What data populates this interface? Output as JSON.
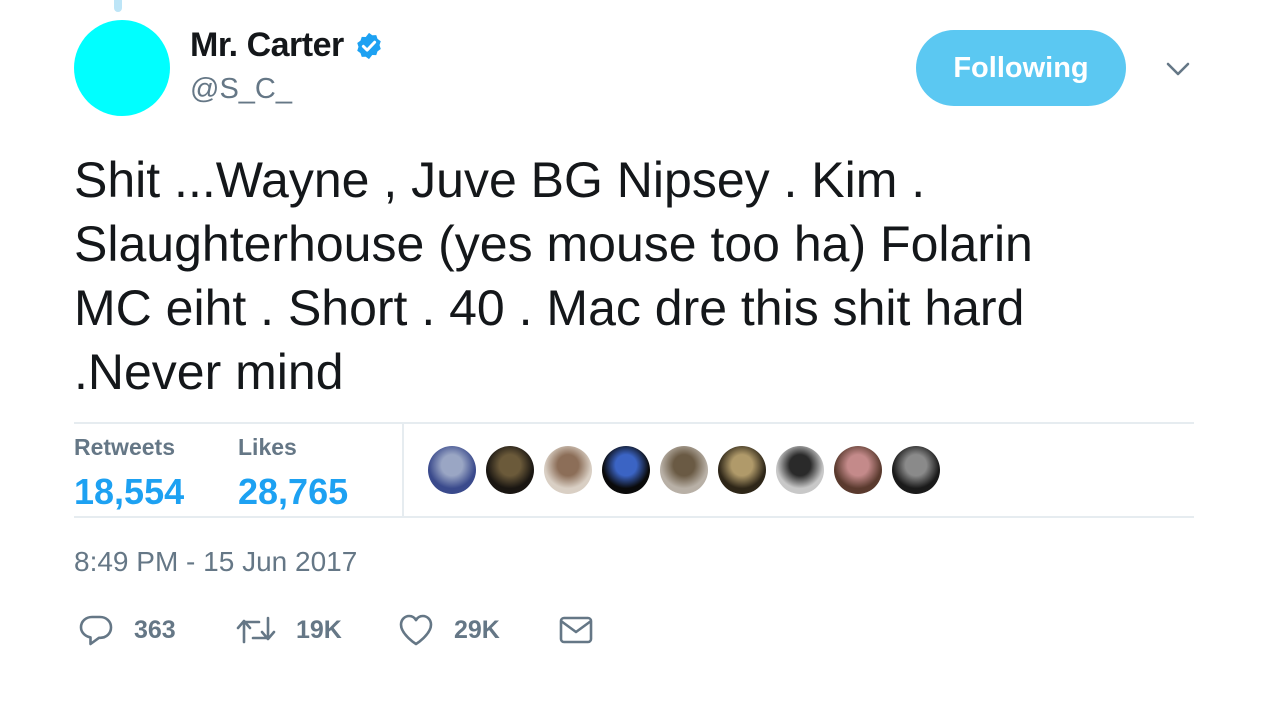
{
  "colors": {
    "accent": "#1da1f2",
    "follow_button": "#5bc8f2",
    "avatar": "#00ffff",
    "muted": "#657786"
  },
  "user": {
    "display_name": "Mr. Carter",
    "handle": "@S_C_",
    "verified_icon": "verified-badge-icon"
  },
  "follow_button": {
    "label": "Following"
  },
  "menu_icon": "chevron-down-icon",
  "tweet": {
    "lines": [
      "Shit ...Wayne , Juve BG Nipsey . Kim .",
      "Slaughterhouse (yes mouse too ha) Folarin",
      "MC eiht . Short . 40 . Mac dre this shit hard",
      ".Never mind"
    ]
  },
  "stats": {
    "retweets_label": "Retweets",
    "retweets_value": "18,554",
    "likes_label": "Likes",
    "likes_value": "28,765"
  },
  "likers": [
    {
      "colors": [
        "#3a4a8c",
        "#9aa6c4"
      ]
    },
    {
      "colors": [
        "#1a1612",
        "#6b5a3a"
      ]
    },
    {
      "colors": [
        "#d9cfc4",
        "#8c6e58"
      ]
    },
    {
      "colors": [
        "#0a0a0a",
        "#3b64c4"
      ]
    },
    {
      "colors": [
        "#b8b0a6",
        "#6a5a44"
      ]
    },
    {
      "colors": [
        "#2e2618",
        "#b09a6a"
      ]
    },
    {
      "colors": [
        "#c8c8c8",
        "#2a2a2a"
      ]
    },
    {
      "colors": [
        "#5a3a2e",
        "#c48a8a"
      ]
    },
    {
      "colors": [
        "#1a1a1a",
        "#8a8a8a"
      ]
    }
  ],
  "timestamp": "8:49 PM - 15 Jun 2017",
  "actions": {
    "reply": {
      "icon": "reply-icon",
      "count": "363"
    },
    "retweet": {
      "icon": "retweet-icon",
      "count": "19K"
    },
    "like": {
      "icon": "heart-icon",
      "count": "29K"
    },
    "message": {
      "icon": "envelope-icon"
    }
  }
}
